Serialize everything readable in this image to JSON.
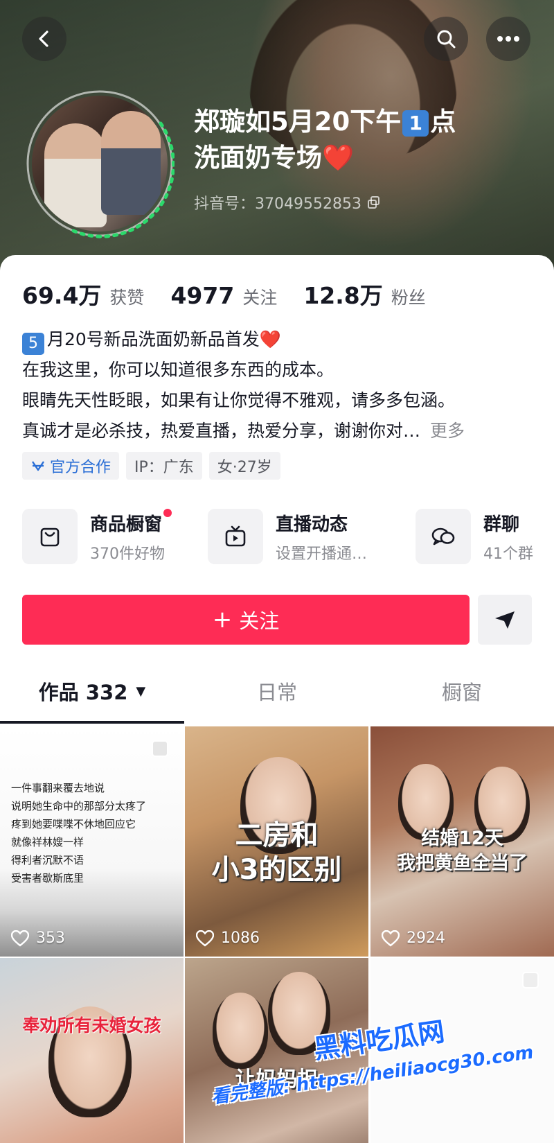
{
  "header": {
    "title_part1": "郑璇如5月20下午",
    "title_badge": "1",
    "title_part2": "点",
    "title_line2": "洗面奶专场",
    "title_heart": "❤️",
    "douyin_id": "抖音号：37049552853"
  },
  "stats": [
    {
      "value": "69.4万",
      "label": "获赞"
    },
    {
      "value": "4977",
      "label": "关注"
    },
    {
      "value": "12.8万",
      "label": "粉丝"
    }
  ],
  "bio": {
    "line1_badge": "5",
    "line1_text": "月20号新品洗面奶新品首发",
    "line1_heart": "❤️",
    "line2": "在我这里，你可以知道很多东西的成本。",
    "line3": "眼睛先天性眨眼，如果有让你觉得不雅观，请多多包涵。",
    "line4": "真诚才是必杀技，热爱直播，热爱分享，谢谢你对…",
    "more": "更多"
  },
  "tags": [
    {
      "label": "官方合作",
      "icon": "official-cooperation-icon"
    },
    {
      "label": "IP：广东"
    },
    {
      "label": "女·27岁"
    }
  ],
  "services": [
    {
      "title": "商品橱窗",
      "subtitle": "370件好物",
      "icon": "shopping-bag-icon",
      "has_dot": true
    },
    {
      "title": "直播动态",
      "subtitle": "设置开播通…",
      "icon": "tv-icon"
    },
    {
      "title": "群聊",
      "subtitle": "41个群",
      "icon": "chat-bubbles-icon"
    }
  ],
  "follow": {
    "label": "关注",
    "plus": "+"
  },
  "tabs": [
    {
      "label": "作品 332",
      "active": true,
      "caret": "▼"
    },
    {
      "label": "日常",
      "active": false
    },
    {
      "label": "橱窗",
      "active": false
    }
  ],
  "videos": [
    {
      "likes": "353",
      "text_lines": [
        "一件事翻来覆去地说",
        "说明她生命中的那部分太疼了",
        "疼到她要喋喋不休地回应它",
        "就像祥林嫂一样",
        "得利者沉默不语",
        "受害者歇斯底里"
      ]
    },
    {
      "likes": "1086",
      "caption": "二房和\n小3的区别"
    },
    {
      "likes": "2924",
      "caption": "结婚12天\n我把黄鱼全当了"
    },
    {
      "caption": "奉劝所有未婚女孩"
    },
    {
      "caption": "让妈妈担"
    },
    {
      "caption": ""
    }
  ],
  "watermark": {
    "line1": "黑料吃瓜网",
    "line2": "看完整版: https://heiliaocg30.com"
  },
  "colors": {
    "accent": "#fe2c55",
    "blue_badge": "#3b82d6",
    "text": "#161823",
    "muted": "#8a8b91"
  }
}
